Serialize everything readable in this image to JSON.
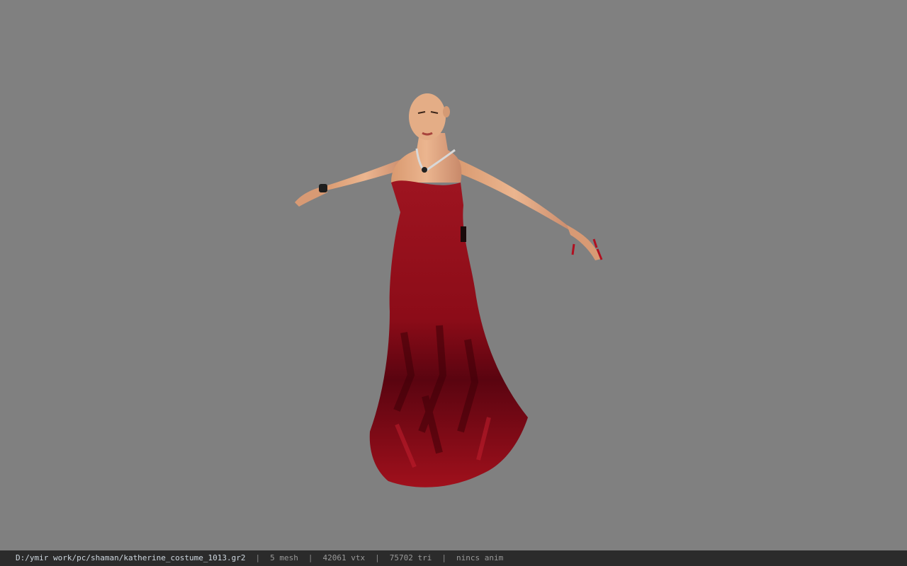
{
  "viewport": {
    "background_color": "#808080",
    "model": {
      "dress_color": "#a0101c",
      "dress_shadow_color": "#4a0008",
      "skin_color": "#e2a882"
    }
  },
  "statusbar": {
    "file_path": "D:/ymir work/pc/shaman/katherine_costume_1013.gr2",
    "separator": "|",
    "mesh": "5 mesh",
    "vertices": "42061 vtx",
    "triangles": "75702 tri",
    "animation": "nincs anim"
  }
}
